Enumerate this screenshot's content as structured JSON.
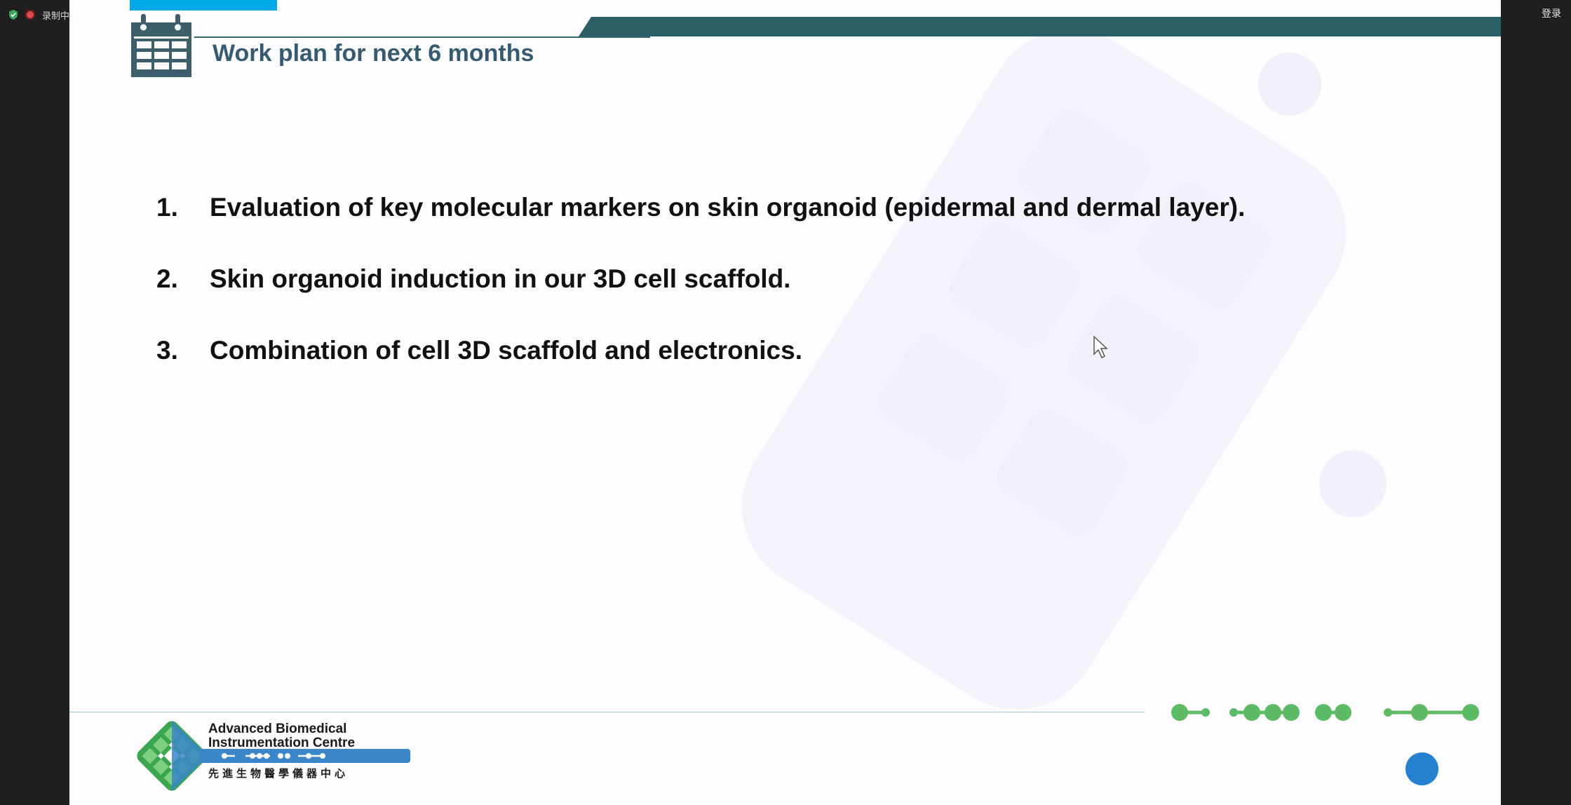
{
  "app": {
    "recording_label": "录制中",
    "login_label": "登录"
  },
  "slide": {
    "title": "Work plan for next 6 months",
    "items": [
      {
        "number": "1.",
        "text": "Evaluation of key molecular markers on skin organoid (epidermal and dermal layer)."
      },
      {
        "number": "2.",
        "text": "Skin organoid induction in our 3D cell scaffold."
      },
      {
        "number": "3.",
        "text": "Combination of cell 3D scaffold and electronics."
      }
    ],
    "logo": {
      "line1": "Advanced Biomedical",
      "line2": "Instrumentation Centre",
      "chinese": "先進生物醫學儀器中心"
    }
  },
  "colors": {
    "title": "#365a70",
    "accent_band": "#2b5f68",
    "cyan_tab": "#02a9e8",
    "green_dots": "#5dbb66",
    "blue_button": "#2580cf"
  },
  "icons": {
    "header": "calendar-icon",
    "cursor": "mouse-pointer-icon",
    "shield": "shield-check-icon",
    "record": "record-icon"
  }
}
